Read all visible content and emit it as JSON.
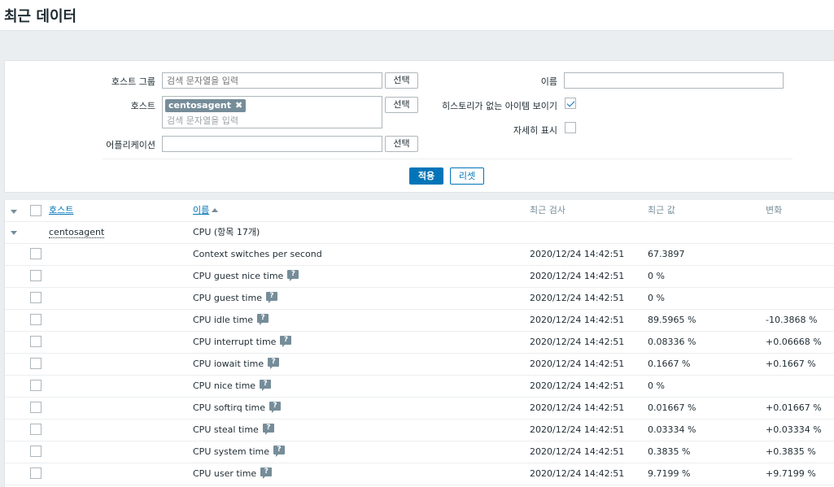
{
  "page": {
    "title": "최근 데이터"
  },
  "filter": {
    "host_group_label": "호스트 그룹",
    "host_group_placeholder": "검색 문자열을 입력",
    "host_label": "호스트",
    "host_chip": "centosagent",
    "host_placeholder": "검색 문자열을 입력",
    "application_label": "어플리케이션",
    "application_value": "",
    "select_label": "선택",
    "name_label": "이름",
    "name_value": "",
    "show_items_without_history_label": "히스토리가 없는 아이템 보이기",
    "show_items_without_history_checked": true,
    "show_details_label": "자세히 표시",
    "show_details_checked": false,
    "apply_label": "적용",
    "reset_label": "리셋"
  },
  "table": {
    "headers": {
      "host": "호스트",
      "name": "이름",
      "last_check": "최근 검사",
      "last_value": "최근 값",
      "change": "변화"
    },
    "group": {
      "host": "centosagent",
      "name": "CPU (항목 17개)"
    },
    "rows": [
      {
        "name": "Context switches per second",
        "has_help": false,
        "last_check": "2020/12/24 14:42:51",
        "last_value": "67.3897",
        "change": ""
      },
      {
        "name": "CPU guest nice time",
        "has_help": true,
        "last_check": "2020/12/24 14:42:51",
        "last_value": "0 %",
        "change": ""
      },
      {
        "name": "CPU guest time",
        "has_help": true,
        "last_check": "2020/12/24 14:42:51",
        "last_value": "0 %",
        "change": ""
      },
      {
        "name": "CPU idle time",
        "has_help": true,
        "last_check": "2020/12/24 14:42:51",
        "last_value": "89.5965 %",
        "change": "-10.3868 %"
      },
      {
        "name": "CPU interrupt time",
        "has_help": true,
        "last_check": "2020/12/24 14:42:51",
        "last_value": "0.08336 %",
        "change": "+0.06668 %"
      },
      {
        "name": "CPU iowait time",
        "has_help": true,
        "last_check": "2020/12/24 14:42:51",
        "last_value": "0.1667 %",
        "change": "+0.1667 %"
      },
      {
        "name": "CPU nice time",
        "has_help": true,
        "last_check": "2020/12/24 14:42:51",
        "last_value": "0 %",
        "change": ""
      },
      {
        "name": "CPU softirq time",
        "has_help": true,
        "last_check": "2020/12/24 14:42:51",
        "last_value": "0.01667 %",
        "change": "+0.01667 %"
      },
      {
        "name": "CPU steal time",
        "has_help": true,
        "last_check": "2020/12/24 14:42:51",
        "last_value": "0.03334 %",
        "change": "+0.03334 %"
      },
      {
        "name": "CPU system time",
        "has_help": true,
        "last_check": "2020/12/24 14:42:51",
        "last_value": "0.3835 %",
        "change": "+0.3835 %"
      },
      {
        "name": "CPU user time",
        "has_help": true,
        "last_check": "2020/12/24 14:42:51",
        "last_value": "9.7199 %",
        "change": "+9.7199 %"
      }
    ]
  },
  "icons": {
    "help": "help-bubble-icon",
    "remove_chip": "close-icon",
    "collapse": "triangle-down-icon",
    "sort": "sort-asc-icon"
  },
  "colors": {
    "accent": "#0275b8",
    "chip": "#768d99"
  }
}
